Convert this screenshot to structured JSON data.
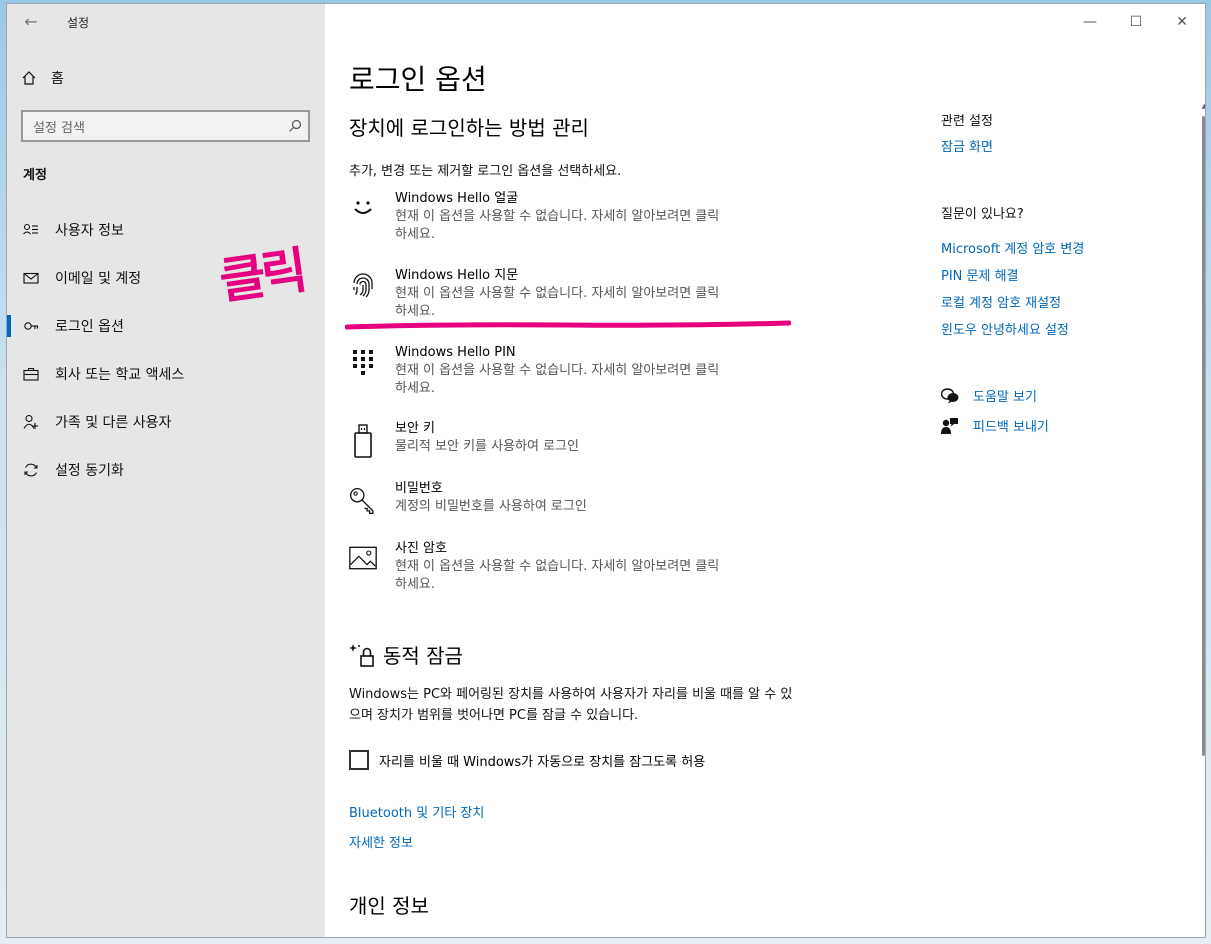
{
  "window": {
    "back_icon": "back-arrow-icon",
    "title": "설정",
    "controls": [
      "minimize-icon",
      "maximize-icon",
      "close-icon"
    ]
  },
  "sidebar": {
    "home_label": "홈",
    "search_placeholder": "설정 검색",
    "section_label": "계정",
    "items": [
      {
        "label": "사용자 정보",
        "icon": "user-info-icon",
        "active": false
      },
      {
        "label": "이메일 및 계정",
        "icon": "mail-icon",
        "active": false
      },
      {
        "label": "로그인 옵션",
        "icon": "key-icon",
        "active": true
      },
      {
        "label": "회사 또는 학교 액세스",
        "icon": "briefcase-icon",
        "active": false
      },
      {
        "label": "가족 및 다른 사용자",
        "icon": "person-add-icon",
        "active": false
      },
      {
        "label": "설정 동기화",
        "icon": "sync-icon",
        "active": false
      }
    ]
  },
  "annotation": {
    "text": "클릭",
    "color": "#e5007f"
  },
  "main": {
    "title": "로그인 옵션",
    "subtitle": "장치에 로그인하는 방법 관리",
    "intro": "추가, 변경 또는 제거할 로그인 옵션을 선택하세요.",
    "options": [
      {
        "title": "Windows Hello 얼굴",
        "desc_line1": "현재 이 옵션을 사용할 수 없습니다. 자세히 알아보려면 클릭",
        "desc_line2": "하세요.",
        "icon": "face-icon"
      },
      {
        "title": "Windows Hello 지문",
        "desc_line1": "현재 이 옵션을 사용할 수 없습니다. 자세히 알아보려면 클릭",
        "desc_line2": "하세요.",
        "icon": "fingerprint-icon"
      },
      {
        "title": "Windows Hello PIN",
        "desc_line1": "현재 이 옵션을 사용할 수 없습니다. 자세히 알아보려면 클릭",
        "desc_line2": "하세요.",
        "icon": "pin-keypad-icon"
      },
      {
        "title": "보안 키",
        "desc_line1": "물리적 보안 키를 사용하여 로그인",
        "desc_line2": "",
        "icon": "usb-key-icon"
      },
      {
        "title": "비밀번호",
        "desc_line1": "계정의 비밀번호를 사용하여 로그인",
        "desc_line2": "",
        "icon": "password-key-icon"
      },
      {
        "title": "사진 암호",
        "desc_line1": "현재 이 옵션을 사용할 수 없습니다. 자세히 알아보려면 클릭",
        "desc_line2": "하세요.",
        "icon": "picture-icon"
      }
    ],
    "dynamic_lock": {
      "title": "동적 잠금",
      "desc": "Windows는 PC와 페어링된 장치를 사용하여 사용자가 자리를 비울 때를 알 수 있으며 장치가 범위를 벗어나면 PC를 잠글 수 있습니다.",
      "checkbox_label": "자리를 비울 때 Windows가 자동으로 장치를 잠그도록 허용",
      "checked": false
    },
    "bluetooth_link": "Bluetooth 및 기타 장치",
    "more_info_link": "자세한 정보",
    "privacy_title": "개인 정보"
  },
  "right": {
    "related_heading": "관련 설정",
    "lock_screen_link": "잠금 화면",
    "question_heading": "질문이 있나요?",
    "links": [
      "Microsoft 계정 암호 변경",
      "PIN 문제 해결",
      "로컬 계정 암호 재설정",
      "윈도우 안녕하세요 설정"
    ],
    "help_link": "도움말 보기",
    "feedback_link": "피드백 보내기"
  },
  "colors": {
    "accent": "#0067b8",
    "sidebar_bg": "#e6e6e6",
    "annotation": "#e5007f"
  }
}
